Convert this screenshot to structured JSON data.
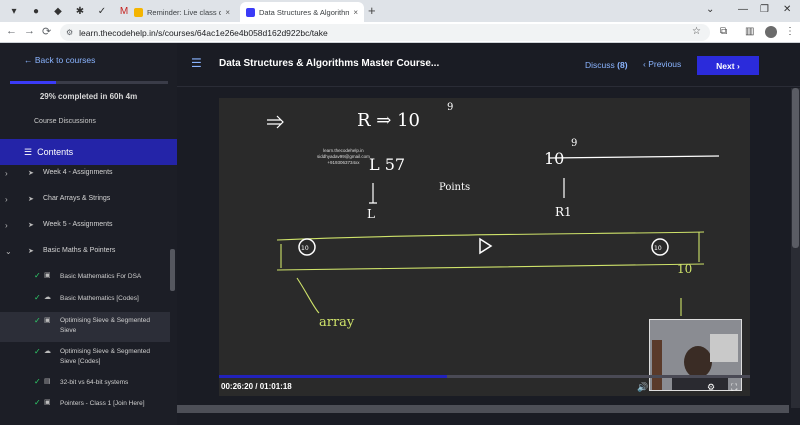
{
  "browser": {
    "tabs": [
      {
        "title": "Reminder: Live class on in -",
        "close": "×"
      },
      {
        "title": "Data Structures & Algorithms M",
        "close": "×"
      }
    ],
    "new_tab": "+",
    "url": "learn.thecodehelp.in/s/courses/64ac1e26e4b058d162d922bc/take"
  },
  "sidebar": {
    "back_label": "Back to courses",
    "progress_percent": 29,
    "progress_text": "29% completed in 60h 4m",
    "discussions_label": "Course Discussions",
    "contents_label": "Contents",
    "sections": [
      {
        "label": "Week 4 - Assignments"
      },
      {
        "label": "Char Arrays & Strings"
      },
      {
        "label": "Week 5 - Assignments"
      },
      {
        "label": "Basic Maths & Pointers"
      }
    ],
    "lessons": [
      {
        "label": "Basic Mathematics For DSA",
        "kind": "video"
      },
      {
        "label": "Basic Mathematics [Codes]",
        "kind": "code"
      },
      {
        "label": "Optimising Sieve & Segmented Sieve",
        "kind": "video"
      },
      {
        "label": "Optimising Sieve & Segmented Sieve [Codes]",
        "kind": "code"
      },
      {
        "label": "32-bit vs 64-bit systems",
        "kind": "doc"
      },
      {
        "label": "Pointers - Class 1 [Join Here]",
        "kind": "video"
      }
    ]
  },
  "header": {
    "course_title": "Data Structures & Algorithms Master Course...",
    "discuss_label": "Discuss",
    "discuss_count": "(8)",
    "previous_label": "Previous",
    "next_label": "Next"
  },
  "video": {
    "current_time": "00:26:20",
    "duration": "/ 01:01:18",
    "progress_fraction": 0.43,
    "watermark": [
      "learn.thecodehelp.in",
      "siddhyadav99@gmail.com",
      "+9193063734xx"
    ],
    "board": {
      "top_left": "R ⇒ 10",
      "exp": "9",
      "mid_left": "L 57",
      "mid_right": "10",
      "points_label": "Points",
      "L": "L",
      "R1": "R1",
      "array_label": "array",
      "bottom_right": "10",
      "skip_back": "10",
      "skip_fwd": "10"
    }
  }
}
